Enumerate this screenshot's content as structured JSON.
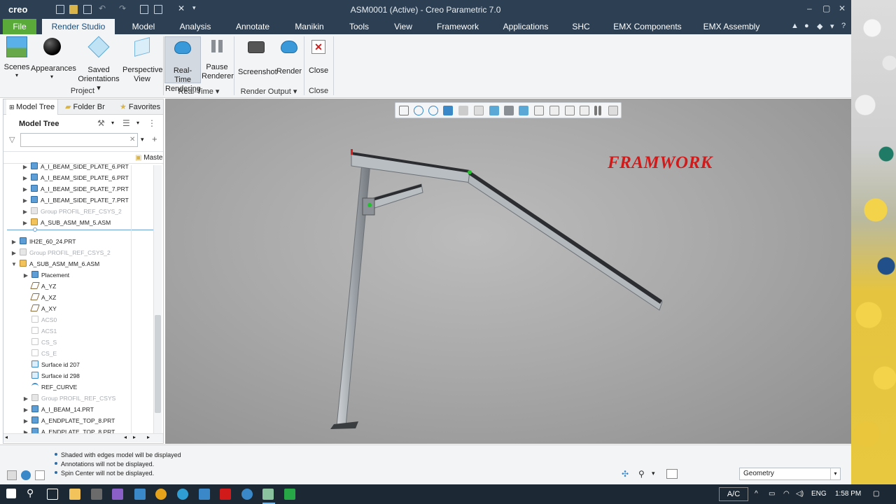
{
  "window": {
    "app_logo": "creo",
    "title": "ASM0001 (Active) - Creo Parametric 7.0",
    "controls": [
      "–",
      "▢",
      "✕"
    ]
  },
  "menu": {
    "tabs": [
      "File",
      "Render Studio",
      "Model",
      "Analysis",
      "Annotate",
      "Manikin",
      "Tools",
      "View",
      "Framework",
      "Applications",
      "SHC",
      "EMX Components",
      "EMX Assembly"
    ],
    "active_tab": "Render Studio"
  },
  "ribbon": {
    "buttons": {
      "scenes": "Scenes",
      "appearances": "Appearances",
      "saved_orientations_1": "Saved",
      "saved_orientations_2": "Orientations",
      "perspective_1": "Perspective",
      "perspective_2": "View",
      "realtime_1": "Real-Time",
      "realtime_2": "Rendering",
      "pause_1": "Pause",
      "pause_2": "Renderer",
      "screenshot": "Screenshot",
      "render": "Render",
      "close": "Close"
    },
    "groups": {
      "project": "Project",
      "realtime": "Real-Time",
      "render_output": "Render Output",
      "close": "Close"
    }
  },
  "left_panel": {
    "tabs": [
      "Model Tree",
      "Folder Br",
      "Favorites"
    ],
    "header": "Model Tree",
    "search_placeholder": "",
    "column": "Maste",
    "rows_top": [
      {
        "label": "A_I_BEAM_SIDE_PLATE_6.PRT",
        "icon": "part",
        "dim": false
      },
      {
        "label": "A_I_BEAM_SIDE_PLATE_6.PRT",
        "icon": "part",
        "dim": false
      },
      {
        "label": "A_I_BEAM_SIDE_PLATE_7.PRT",
        "icon": "part",
        "dim": false
      },
      {
        "label": "A_I_BEAM_SIDE_PLATE_7.PRT",
        "icon": "part",
        "dim": false
      },
      {
        "label": "Group PROFIL_REF_CSYS_2",
        "icon": "grp",
        "dim": true
      },
      {
        "label": "A_SUB_ASM_MM_5.ASM",
        "icon": "asm",
        "dim": false
      }
    ],
    "rows_bottom": [
      {
        "label": "IH2E_60_24.PRT",
        "icon": "part",
        "dim": false,
        "arrow": "▶",
        "indent": 0
      },
      {
        "label": "Group PROFIL_REF_CSYS_2",
        "icon": "grp",
        "dim": true,
        "arrow": "▶",
        "indent": 0
      },
      {
        "label": "A_SUB_ASM_MM_6.ASM",
        "icon": "asm",
        "dim": false,
        "arrow": "▼",
        "indent": 0
      },
      {
        "label": "Placement",
        "icon": "part",
        "dim": false,
        "arrow": "▶",
        "indent": 1
      },
      {
        "label": "A_YZ",
        "icon": "plane",
        "dim": false,
        "arrow": "",
        "indent": 1
      },
      {
        "label": "A_XZ",
        "icon": "plane",
        "dim": false,
        "arrow": "",
        "indent": 1
      },
      {
        "label": "A_XY",
        "icon": "plane",
        "dim": false,
        "arrow": "",
        "indent": 1
      },
      {
        "label": "ACS0",
        "icon": "csys",
        "dim": true,
        "arrow": "",
        "indent": 1
      },
      {
        "label": "ACS1",
        "icon": "csys",
        "dim": true,
        "arrow": "",
        "indent": 1
      },
      {
        "label": "CS_S",
        "icon": "csys",
        "dim": true,
        "arrow": "",
        "indent": 1
      },
      {
        "label": "CS_E",
        "icon": "csys",
        "dim": true,
        "arrow": "",
        "indent": 1
      },
      {
        "label": "Surface id 207",
        "icon": "surf",
        "dim": false,
        "arrow": "",
        "indent": 1
      },
      {
        "label": "Surface id 298",
        "icon": "surf",
        "dim": false,
        "arrow": "",
        "indent": 1
      },
      {
        "label": "REF_CURVE",
        "icon": "curve",
        "dim": false,
        "arrow": "",
        "indent": 1
      },
      {
        "label": "Group PROFIL_REF_CSYS",
        "icon": "grp",
        "dim": true,
        "arrow": "▶",
        "indent": 1
      },
      {
        "label": "A_I_BEAM_14.PRT",
        "icon": "part",
        "dim": false,
        "arrow": "▶",
        "indent": 1
      },
      {
        "label": "A_ENDPLATE_TOP_8.PRT",
        "icon": "part",
        "dim": false,
        "arrow": "▶",
        "indent": 1
      },
      {
        "label": "A_ENDPLATE_TOP_8.PRT",
        "icon": "part",
        "dim": false,
        "arrow": "▶",
        "indent": 1
      }
    ]
  },
  "viewport": {
    "annotation": "FRAMWORK",
    "annotation_color": "#d11a1a"
  },
  "status": {
    "messages": [
      "Shaded with edges model will be displayed",
      "Annotations will not be displayed.",
      "Spin Center will not be displayed."
    ],
    "filter_value": "Geometry"
  },
  "taskbar": {
    "language": "ENG",
    "time": "1:58 PM",
    "ac_label": "A/C"
  }
}
